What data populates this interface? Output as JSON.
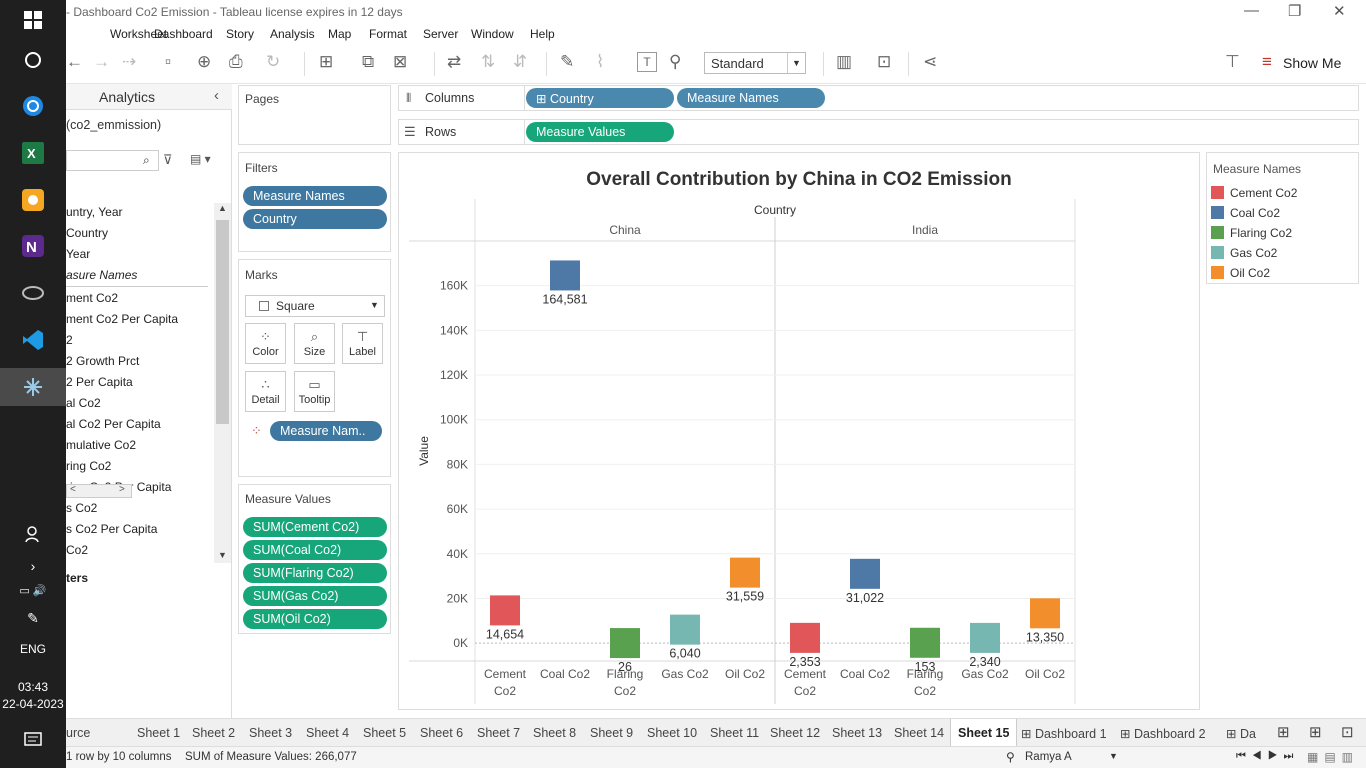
{
  "window": {
    "title": "- Dashboard  Co2 Emission - Tableau license expires in 12 days"
  },
  "menu": [
    "Worksheet",
    "Dashboard",
    "Story",
    "Analysis",
    "Map",
    "Format",
    "Server",
    "Window",
    "Help"
  ],
  "toolbar": {
    "fit": "Standard",
    "show_me": "Show Me"
  },
  "taskbar": {
    "lang": "ENG",
    "time": "03:43",
    "date": "22-04-2023"
  },
  "datapane": {
    "tab": "Analytics",
    "source": "(co2_emmission)",
    "fields": [
      "untry, Year",
      "Country",
      "Year",
      "asure Names",
      "ment Co2",
      "ment Co2 Per Capita",
      "2",
      "2 Growth Prct",
      "2 Per Capita",
      "al Co2",
      "al Co2 Per Capita",
      "mulative Co2",
      "ring Co2",
      "ring Co2 Per Capita",
      "s Co2",
      "s Co2 Per Capita",
      "Co2"
    ],
    "params_label": "ters"
  },
  "pages": {
    "title": "Pages"
  },
  "filters": {
    "title": "Filters",
    "items": [
      "Measure Names",
      "Country"
    ]
  },
  "marks": {
    "title": "Marks",
    "type": "Square",
    "buttons": [
      "Color",
      "Size",
      "Label",
      "Detail",
      "Tooltip"
    ],
    "color_pill": "Measure Nam.."
  },
  "measure_values": {
    "title": "Measure Values",
    "items": [
      "SUM(Cement Co2)",
      "SUM(Coal Co2)",
      "SUM(Flaring Co2)",
      "SUM(Gas Co2)",
      "SUM(Oil Co2)"
    ]
  },
  "shelves": {
    "columns_label": "Columns",
    "rows_label": "Rows",
    "columns": [
      "Country",
      "Measure Names"
    ],
    "rows": [
      "Measure Values"
    ]
  },
  "legend": {
    "title": "Measure Names",
    "items": [
      {
        "label": "Cement Co2",
        "color": "#e15759"
      },
      {
        "label": "Coal Co2",
        "color": "#4e79a7"
      },
      {
        "label": "Flaring Co2",
        "color": "#59a14f"
      },
      {
        "label": "Gas Co2",
        "color": "#76b7b2"
      },
      {
        "label": "Oil Co2",
        "color": "#f28e2b"
      }
    ]
  },
  "chart_data": {
    "type": "scatter",
    "title": "Overall Contribution by China in CO2 Emission",
    "xlabel": "Country",
    "ylabel": "Value",
    "ylim": [
      -8000,
      180000
    ],
    "yticks": [
      "0K",
      "20K",
      "40K",
      "60K",
      "80K",
      "100K",
      "120K",
      "140K",
      "160K"
    ],
    "ytick_values": [
      0,
      20000,
      40000,
      60000,
      80000,
      100000,
      120000,
      140000,
      160000
    ],
    "panels": [
      "China",
      "India"
    ],
    "categories": [
      "Cement Co2",
      "Coal Co2",
      "Flaring Co2",
      "Gas Co2",
      "Oil Co2"
    ],
    "series": [
      {
        "name": "China",
        "values": [
          14654,
          164581,
          26,
          6040,
          31559
        ],
        "labels": [
          "14,654",
          "164,581",
          "26",
          "6,040",
          "31,559"
        ]
      },
      {
        "name": "India",
        "values": [
          2353,
          31022,
          153,
          2340,
          13350
        ],
        "labels": [
          "2,353",
          "31,022",
          "153",
          "2,340",
          "13,350"
        ]
      }
    ]
  },
  "tabs": {
    "items": [
      "urce",
      "Sheet 1",
      "Sheet 2",
      "Sheet 3",
      "Sheet 4",
      "Sheet 5",
      "Sheet 6",
      "Sheet 7",
      "Sheet 8",
      "Sheet 9",
      "Sheet 10",
      "Sheet 11",
      "Sheet 12",
      "Sheet 13",
      "Sheet 14",
      "Sheet 15",
      "Dashboard 1",
      "Dashboard 2",
      "Dash"
    ],
    "active": "Sheet 15"
  },
  "status": {
    "rows": "1 row by 10 columns",
    "sum": "SUM of Measure Values: 266,077",
    "user": "Ramya A"
  }
}
